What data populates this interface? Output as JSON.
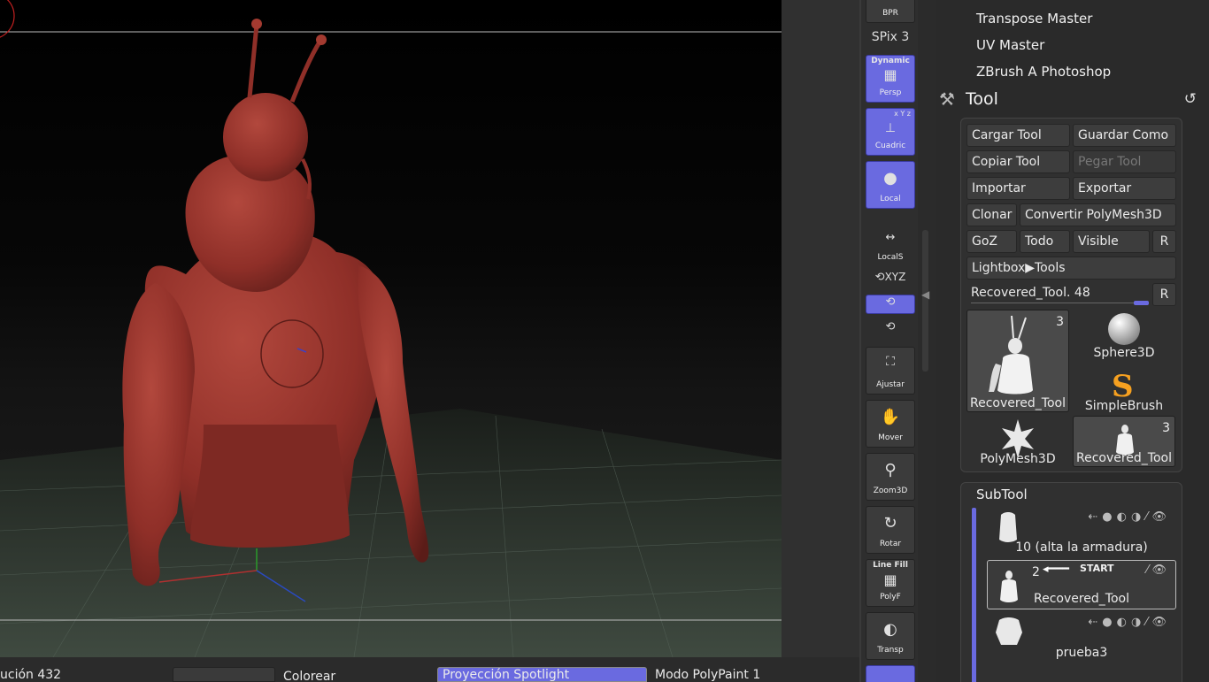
{
  "bottom_bar": {
    "resolution_label": "ución 432",
    "colorize_label": "Colorear",
    "spotlight_label": "Proyección Spotlight",
    "polypaint_label": "Modo PolyPaint 1"
  },
  "shelf": {
    "bpr": "BPR",
    "spix": "SPix 3",
    "dynamic": "Dynamic",
    "persp": "Persp",
    "cuadric": "Cuadric",
    "xyz_small": "x Y z",
    "local": "Local",
    "locals": "LocalS",
    "xyz": "XYZ",
    "ajustar": "Ajustar",
    "mover": "Mover",
    "zoom3d": "Zoom3D",
    "rotar": "Rotar",
    "linefill": "Line Fill",
    "polyf": "PolyF",
    "transp": "Transp"
  },
  "plugins": [
    "Transpose Master",
    "UV Master",
    "ZBrush A Photoshop"
  ],
  "tool": {
    "title": "Tool",
    "buttons": {
      "cargar": "Cargar Tool",
      "guardar": "Guardar Como",
      "copiar": "Copiar Tool",
      "pegar": "Pegar Tool",
      "importar": "Importar",
      "exportar": "Exportar",
      "clonar": "Clonar",
      "convertir": "Convertir PolyMesh3D",
      "goz": "GoZ",
      "todo": "Todo",
      "visible": "Visible",
      "r1": "R",
      "lightbox": "Lightbox▶Tools",
      "r2": "R"
    },
    "slider": {
      "label": "Recovered_Tool. 48",
      "value_fraction": 1.0
    },
    "thumbnails": [
      {
        "name": "Recovered_Tool",
        "count": "3"
      },
      {
        "name": "Sphere3D",
        "count": ""
      },
      {
        "name": "SimpleBrush",
        "count": ""
      },
      {
        "name": "PolyMesh3D",
        "count": ""
      },
      {
        "name": "Recovered_Tool",
        "count": "3"
      }
    ]
  },
  "subtool": {
    "title": "SubTool",
    "items": [
      {
        "name": "10 (alta la armadura)",
        "num": ""
      },
      {
        "name": "Recovered_Tool",
        "num": "2",
        "start": "START"
      },
      {
        "name": "prueba3",
        "num": ""
      }
    ]
  },
  "colors": {
    "accent": "#6a6ae0",
    "clay": "#8f2f28",
    "floor_grid": "#3d4a3d"
  }
}
